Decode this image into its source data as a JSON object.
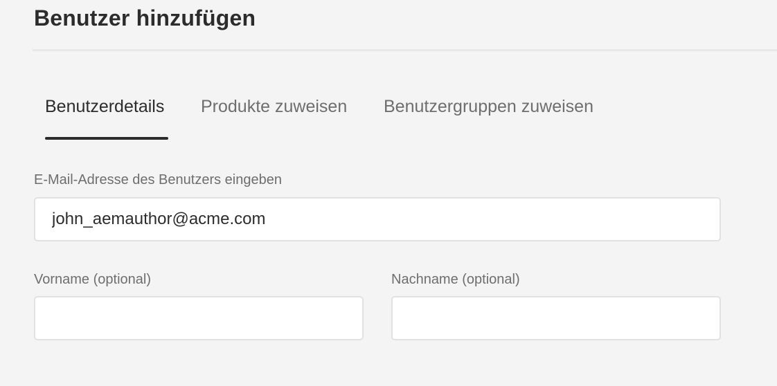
{
  "dialog": {
    "title": "Benutzer hinzufügen"
  },
  "tabs": [
    {
      "label": "Benutzerdetails",
      "selected": true
    },
    {
      "label": "Produkte zuweisen",
      "selected": false
    },
    {
      "label": "Benutzergruppen zuweisen",
      "selected": false
    }
  ],
  "form": {
    "email": {
      "label": "E-Mail-Adresse des Benutzers eingeben",
      "value": "john_aemauthor@acme.com"
    },
    "first_name": {
      "label": "Vorname (optional)",
      "value": ""
    },
    "last_name": {
      "label": "Nachname (optional)",
      "value": ""
    }
  },
  "colors": {
    "background": "#f4f4f4",
    "text": "#2c2c2c",
    "muted_text": "#6e6e6e",
    "input_border": "#e1e1e1"
  }
}
